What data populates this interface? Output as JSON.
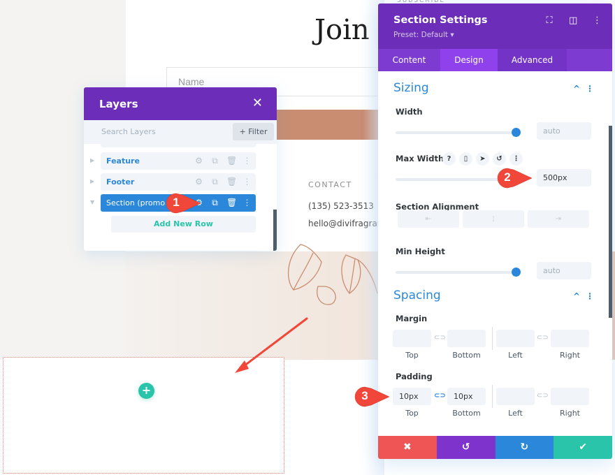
{
  "page": {
    "subscribe_label": "SUBSCRIBE",
    "title": "Join Our",
    "name_placeholder": "Name",
    "contact_heading": "CONTACT",
    "contact_phone": "(135) 523-3513",
    "contact_email": "hello@divifragrance.com",
    "add_section_icon": "+"
  },
  "layers": {
    "title": "Layers",
    "close_icon": "✕",
    "search_placeholder": "Search Layers",
    "filter_label": "+ Filter",
    "items": [
      {
        "label": "Feature",
        "expanded": false
      },
      {
        "label": "Footer",
        "expanded": false
      },
      {
        "label": "Section (promo p",
        "expanded": true,
        "active": true
      }
    ],
    "add_row_label": "Add New Row"
  },
  "settings": {
    "title": "Section Settings",
    "preset": "Preset: Default ▾",
    "tabs": [
      {
        "label": "Content",
        "active": false
      },
      {
        "label": "Design",
        "active": true
      },
      {
        "label": "Advanced",
        "active": false
      }
    ],
    "sizing": {
      "title": "Sizing",
      "width_label": "Width",
      "width_value": "auto",
      "max_width_label": "Max Width",
      "max_width_value": "500px",
      "alignment_label": "Section Alignment",
      "alignment_options": [
        "left",
        "center",
        "right"
      ],
      "min_height_label": "Min Height",
      "min_height_value": "auto"
    },
    "spacing": {
      "title": "Spacing",
      "margin_label": "Margin",
      "padding_label": "Padding",
      "sides": [
        "Top",
        "Bottom",
        "Left",
        "Right"
      ],
      "margin_values": [
        "",
        "",
        "",
        ""
      ],
      "padding_values": [
        "10px",
        "10px",
        "",
        ""
      ]
    },
    "footer": {
      "cancel_icon": "✖",
      "undo_icon": "↺",
      "redo_icon": "↻",
      "save_icon": "✔",
      "colors": {
        "cancel": "#ef5555",
        "undo": "#7e34cc",
        "redo": "#2b87da",
        "save": "#29c4a9"
      }
    }
  },
  "annotations": {
    "step1": "1",
    "step2": "2",
    "step3": "3"
  }
}
